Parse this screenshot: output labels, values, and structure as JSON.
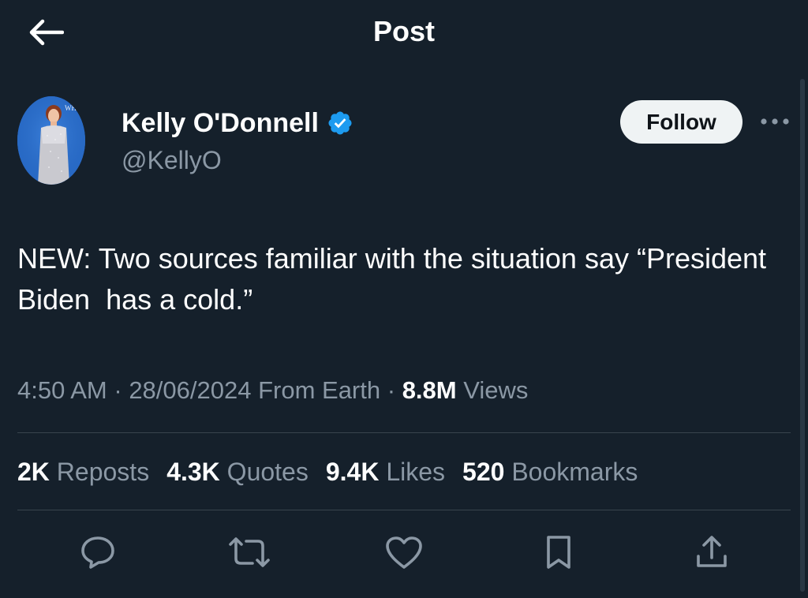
{
  "header": {
    "title": "Post",
    "back_icon": "arrow-left-icon"
  },
  "author": {
    "name": "Kelly O'Donnell",
    "handle": "@KellyO",
    "verified": true,
    "verified_color": "#1d9bf0",
    "avatar_backdrop_text": "WHCA"
  },
  "follow_label": "Follow",
  "more_icon": "more-horizontal-icon",
  "tweet": {
    "text": "NEW: Two sources familiar with the situation say “President Biden  has a cold.”"
  },
  "meta": {
    "time": "4:50 AM",
    "sep1": " · ",
    "date": "28/06/2024",
    "source": " From Earth",
    "sep2": " · ",
    "views_count": "8.8M",
    "views_label": " Views"
  },
  "stats": [
    {
      "count": "2K",
      "label": " Reposts"
    },
    {
      "count": "4.3K",
      "label": " Quotes"
    },
    {
      "count": "9.4K",
      "label": " Likes"
    },
    {
      "count": "520",
      "label": " Bookmarks"
    }
  ],
  "actions": [
    {
      "name": "reply",
      "icon": "reply-icon"
    },
    {
      "name": "repost",
      "icon": "repost-icon"
    },
    {
      "name": "like",
      "icon": "heart-icon"
    },
    {
      "name": "bookmark",
      "icon": "bookmark-icon"
    },
    {
      "name": "share",
      "icon": "share-icon"
    }
  ],
  "colors": {
    "background": "#15202b",
    "text_primary": "#ffffff",
    "text_secondary": "#8b98a5",
    "divider": "#38444d",
    "follow_bg": "#eff3f4",
    "icon": "#8b98a5"
  }
}
